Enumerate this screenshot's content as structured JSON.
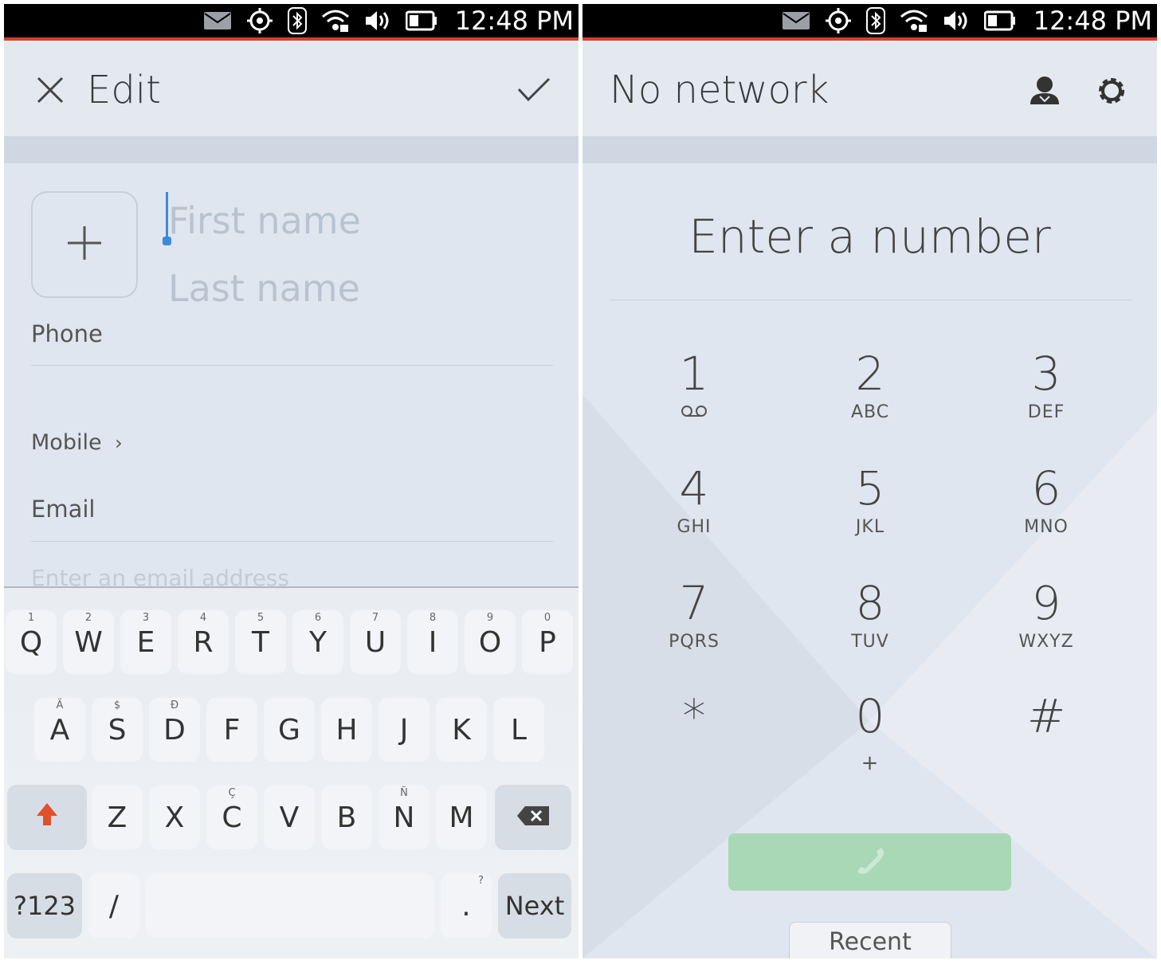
{
  "status_bar": {
    "time": "12:48 PM",
    "icons": [
      "mail-icon",
      "location-icon",
      "bluetooth-icon",
      "wifi-icon",
      "volume-icon",
      "battery-icon"
    ]
  },
  "editor": {
    "title": "Edit",
    "close_icon": "close-icon",
    "confirm_icon": "check-icon",
    "first_name_placeholder": "First name",
    "last_name_placeholder": "Last name",
    "photo_add_icon": "plus-icon",
    "phone_label": "Phone",
    "mobile_label": "Mobile",
    "mobile_chevron": "›",
    "email_label": "Email",
    "email_placeholder": "Enter an email address"
  },
  "keyboard": {
    "row1": [
      {
        "k": "Q",
        "s": "1"
      },
      {
        "k": "W",
        "s": "2"
      },
      {
        "k": "E",
        "s": "3"
      },
      {
        "k": "R",
        "s": "4"
      },
      {
        "k": "T",
        "s": "5"
      },
      {
        "k": "Y",
        "s": "6"
      },
      {
        "k": "U",
        "s": "7"
      },
      {
        "k": "I",
        "s": "8"
      },
      {
        "k": "O",
        "s": "9"
      },
      {
        "k": "P",
        "s": "0"
      }
    ],
    "row2": [
      {
        "k": "A",
        "s": "Ä"
      },
      {
        "k": "S",
        "s": "$"
      },
      {
        "k": "D",
        "s": "Đ"
      },
      {
        "k": "F",
        "s": ""
      },
      {
        "k": "G",
        "s": ""
      },
      {
        "k": "H",
        "s": ""
      },
      {
        "k": "J",
        "s": ""
      },
      {
        "k": "K",
        "s": ""
      },
      {
        "k": "L",
        "s": ""
      }
    ],
    "row3": [
      {
        "k": "Z",
        "s": ""
      },
      {
        "k": "X",
        "s": ""
      },
      {
        "k": "C",
        "s": "Ç"
      },
      {
        "k": "V",
        "s": ""
      },
      {
        "k": "B",
        "s": ""
      },
      {
        "k": "N",
        "s": "Ñ"
      },
      {
        "k": "M",
        "s": ""
      }
    ],
    "symbols_label": "?123",
    "slash_label": "/",
    "period_label": ".",
    "period_sup": "?",
    "next_label": "Next",
    "shift_color": "#e0502c"
  },
  "dialer": {
    "title": "No network",
    "placeholder": "Enter a number",
    "keys": [
      {
        "d": "1",
        "l": ""
      },
      {
        "d": "2",
        "l": "ABC"
      },
      {
        "d": "3",
        "l": "DEF"
      },
      {
        "d": "4",
        "l": "GHI"
      },
      {
        "d": "5",
        "l": "JKL"
      },
      {
        "d": "6",
        "l": "MNO"
      },
      {
        "d": "7",
        "l": "PQRS"
      },
      {
        "d": "8",
        "l": "TUV"
      },
      {
        "d": "9",
        "l": "WXYZ"
      },
      {
        "d": "*",
        "l": ""
      },
      {
        "d": "0",
        "l": "+"
      },
      {
        "d": "#",
        "l": ""
      }
    ],
    "voicemail_icon": "voicemail-icon",
    "contacts_icon": "contacts-icon",
    "settings_icon": "gear-icon",
    "call_icon": "phone-icon",
    "call_color": "#a9d8b6",
    "recent_label": "Recent"
  }
}
